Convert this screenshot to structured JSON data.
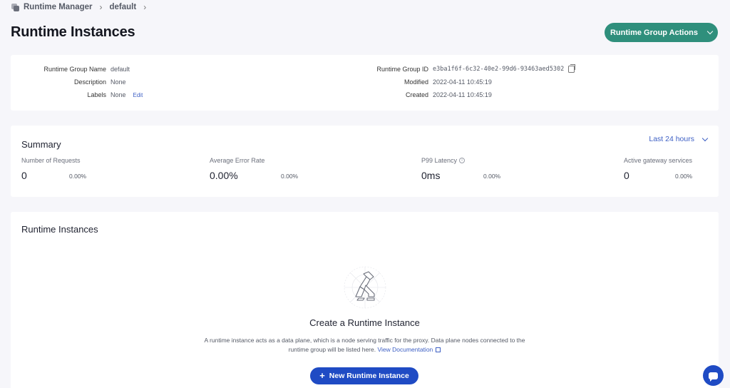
{
  "breadcrumb": {
    "items": [
      "Runtime Manager",
      "default"
    ]
  },
  "page": {
    "title": "Runtime Instances"
  },
  "header": {
    "actions_label": "Runtime Group Actions"
  },
  "info": {
    "left": [
      {
        "label": "Runtime Group Name",
        "value": "default"
      },
      {
        "label": "Description",
        "value": "None"
      },
      {
        "label": "Labels",
        "value": "None",
        "action": "Edit"
      }
    ],
    "right": [
      {
        "label": "Runtime Group ID",
        "value": "e3ba1f6f-6c32-40e2-99d6-93463aed5302"
      },
      {
        "label": "Modified",
        "value": "2022-04-11 10:45:19"
      },
      {
        "label": "Created",
        "value": "2022-04-11 10:45:19"
      }
    ]
  },
  "summary": {
    "title": "Summary",
    "range": "Last 24 hours",
    "metrics": [
      {
        "label": "Number of Requests",
        "value": "0",
        "change": "0.00%"
      },
      {
        "label": "Average Error Rate",
        "value": "0.00%",
        "change": "0.00%"
      },
      {
        "label": "P99 Latency",
        "value": "0ms",
        "change": "0.00%"
      },
      {
        "label": "Active gateway services",
        "value": "0",
        "change": "0.00%"
      }
    ]
  },
  "instances": {
    "title": "Runtime Instances",
    "empty_title": "Create a Runtime Instance",
    "empty_desc": "A runtime instance acts as a data plane, which is a node serving traffic for the proxy. Data plane nodes connected to the runtime group will be listed here.",
    "doc_link": "View Documentation",
    "new_button": "New Runtime Instance"
  },
  "colors": {
    "accent": "#2f8f7c",
    "primary": "#1f4bc4",
    "link": "#3d5fc4"
  },
  "icons": [
    "runtime-manager-icon",
    "chevron-right-icon",
    "chevron-down-icon",
    "copy-icon",
    "info-icon",
    "kong-gorilla-icon",
    "external-link-icon",
    "plus-icon",
    "chat-icon"
  ]
}
